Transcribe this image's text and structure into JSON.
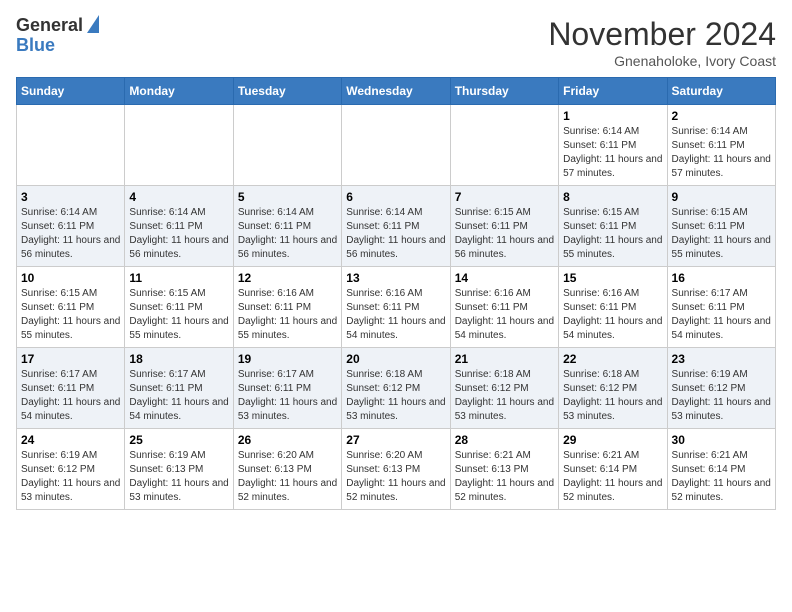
{
  "logo": {
    "line1": "General",
    "line2": "Blue"
  },
  "header": {
    "month": "November 2024",
    "location": "Gnenaholoke, Ivory Coast"
  },
  "weekdays": [
    "Sunday",
    "Monday",
    "Tuesday",
    "Wednesday",
    "Thursday",
    "Friday",
    "Saturday"
  ],
  "weeks": [
    [
      {
        "day": "",
        "info": ""
      },
      {
        "day": "",
        "info": ""
      },
      {
        "day": "",
        "info": ""
      },
      {
        "day": "",
        "info": ""
      },
      {
        "day": "",
        "info": ""
      },
      {
        "day": "1",
        "info": "Sunrise: 6:14 AM\nSunset: 6:11 PM\nDaylight: 11 hours and 57 minutes."
      },
      {
        "day": "2",
        "info": "Sunrise: 6:14 AM\nSunset: 6:11 PM\nDaylight: 11 hours and 57 minutes."
      }
    ],
    [
      {
        "day": "3",
        "info": "Sunrise: 6:14 AM\nSunset: 6:11 PM\nDaylight: 11 hours and 56 minutes."
      },
      {
        "day": "4",
        "info": "Sunrise: 6:14 AM\nSunset: 6:11 PM\nDaylight: 11 hours and 56 minutes."
      },
      {
        "day": "5",
        "info": "Sunrise: 6:14 AM\nSunset: 6:11 PM\nDaylight: 11 hours and 56 minutes."
      },
      {
        "day": "6",
        "info": "Sunrise: 6:14 AM\nSunset: 6:11 PM\nDaylight: 11 hours and 56 minutes."
      },
      {
        "day": "7",
        "info": "Sunrise: 6:15 AM\nSunset: 6:11 PM\nDaylight: 11 hours and 56 minutes."
      },
      {
        "day": "8",
        "info": "Sunrise: 6:15 AM\nSunset: 6:11 PM\nDaylight: 11 hours and 55 minutes."
      },
      {
        "day": "9",
        "info": "Sunrise: 6:15 AM\nSunset: 6:11 PM\nDaylight: 11 hours and 55 minutes."
      }
    ],
    [
      {
        "day": "10",
        "info": "Sunrise: 6:15 AM\nSunset: 6:11 PM\nDaylight: 11 hours and 55 minutes."
      },
      {
        "day": "11",
        "info": "Sunrise: 6:15 AM\nSunset: 6:11 PM\nDaylight: 11 hours and 55 minutes."
      },
      {
        "day": "12",
        "info": "Sunrise: 6:16 AM\nSunset: 6:11 PM\nDaylight: 11 hours and 55 minutes."
      },
      {
        "day": "13",
        "info": "Sunrise: 6:16 AM\nSunset: 6:11 PM\nDaylight: 11 hours and 54 minutes."
      },
      {
        "day": "14",
        "info": "Sunrise: 6:16 AM\nSunset: 6:11 PM\nDaylight: 11 hours and 54 minutes."
      },
      {
        "day": "15",
        "info": "Sunrise: 6:16 AM\nSunset: 6:11 PM\nDaylight: 11 hours and 54 minutes."
      },
      {
        "day": "16",
        "info": "Sunrise: 6:17 AM\nSunset: 6:11 PM\nDaylight: 11 hours and 54 minutes."
      }
    ],
    [
      {
        "day": "17",
        "info": "Sunrise: 6:17 AM\nSunset: 6:11 PM\nDaylight: 11 hours and 54 minutes."
      },
      {
        "day": "18",
        "info": "Sunrise: 6:17 AM\nSunset: 6:11 PM\nDaylight: 11 hours and 54 minutes."
      },
      {
        "day": "19",
        "info": "Sunrise: 6:17 AM\nSunset: 6:11 PM\nDaylight: 11 hours and 53 minutes."
      },
      {
        "day": "20",
        "info": "Sunrise: 6:18 AM\nSunset: 6:12 PM\nDaylight: 11 hours and 53 minutes."
      },
      {
        "day": "21",
        "info": "Sunrise: 6:18 AM\nSunset: 6:12 PM\nDaylight: 11 hours and 53 minutes."
      },
      {
        "day": "22",
        "info": "Sunrise: 6:18 AM\nSunset: 6:12 PM\nDaylight: 11 hours and 53 minutes."
      },
      {
        "day": "23",
        "info": "Sunrise: 6:19 AM\nSunset: 6:12 PM\nDaylight: 11 hours and 53 minutes."
      }
    ],
    [
      {
        "day": "24",
        "info": "Sunrise: 6:19 AM\nSunset: 6:12 PM\nDaylight: 11 hours and 53 minutes."
      },
      {
        "day": "25",
        "info": "Sunrise: 6:19 AM\nSunset: 6:13 PM\nDaylight: 11 hours and 53 minutes."
      },
      {
        "day": "26",
        "info": "Sunrise: 6:20 AM\nSunset: 6:13 PM\nDaylight: 11 hours and 52 minutes."
      },
      {
        "day": "27",
        "info": "Sunrise: 6:20 AM\nSunset: 6:13 PM\nDaylight: 11 hours and 52 minutes."
      },
      {
        "day": "28",
        "info": "Sunrise: 6:21 AM\nSunset: 6:13 PM\nDaylight: 11 hours and 52 minutes."
      },
      {
        "day": "29",
        "info": "Sunrise: 6:21 AM\nSunset: 6:14 PM\nDaylight: 11 hours and 52 minutes."
      },
      {
        "day": "30",
        "info": "Sunrise: 6:21 AM\nSunset: 6:14 PM\nDaylight: 11 hours and 52 minutes."
      }
    ]
  ]
}
